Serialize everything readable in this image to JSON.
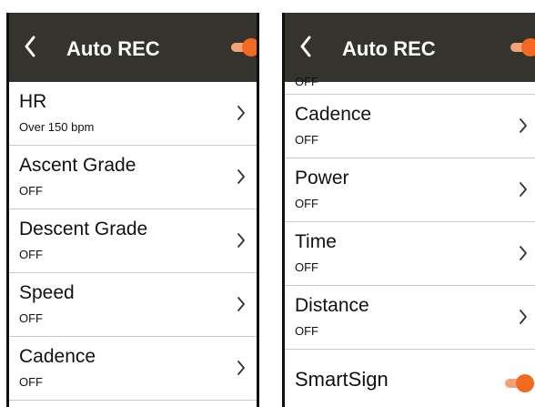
{
  "left_screen": {
    "header": {
      "title": "Auto REC",
      "toggle_on": true
    },
    "rows": [
      {
        "label": "HR",
        "value": "Over 150 bpm"
      },
      {
        "label": "Ascent Grade",
        "value": "OFF"
      },
      {
        "label": "Descent Grade",
        "value": "OFF"
      },
      {
        "label": "Speed",
        "value": "OFF"
      },
      {
        "label": "Cadence",
        "value": "OFF"
      }
    ]
  },
  "right_screen": {
    "header": {
      "title": "Auto REC",
      "toggle_on": true
    },
    "partial_row_value": "OFF",
    "rows": [
      {
        "label": "Cadence",
        "value": "OFF"
      },
      {
        "label": "Power",
        "value": "OFF"
      },
      {
        "label": "Time",
        "value": "OFF"
      },
      {
        "label": "Distance",
        "value": "OFF"
      }
    ],
    "smartsign": {
      "label": "SmartSign",
      "toggle_on": true
    }
  },
  "colors": {
    "header_bg": "#34332e",
    "accent": "#f26a22",
    "accent_track": "#f2a27a",
    "divider": "#c9c9c9"
  },
  "icons": [
    "back-arrow-icon",
    "chevron-right-icon"
  ]
}
